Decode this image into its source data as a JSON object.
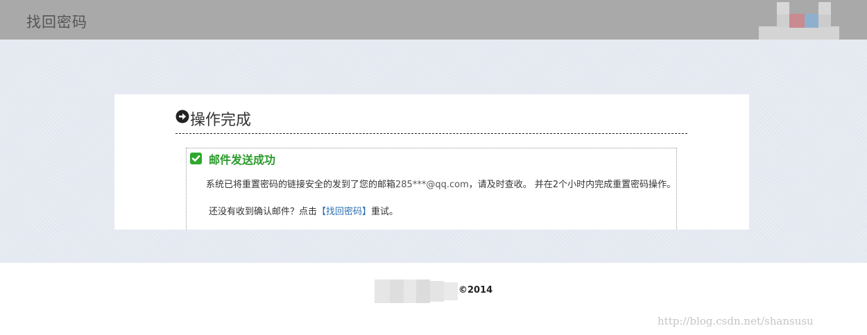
{
  "header": {
    "title": "找回密码"
  },
  "panel": {
    "heading": "操作完成",
    "heading_icon": "arrow-circle-right-icon"
  },
  "message": {
    "icon": "check-square-icon",
    "title": "邮件发送成功",
    "line1_before": "系统已将重置密码的链接安全的发到了您的邮箱",
    "email": "285***@qq.com",
    "line1_after": "，请及时查收。 并在2个小时内完成重置密码操作。",
    "line2_before": "还没有收到确认邮件？点击",
    "retry_link": "【找回密码】",
    "line2_after": "重试。"
  },
  "footer": {
    "copyright": "©2014"
  },
  "watermark": "http://blog.csdn.net/shansusu",
  "colors": {
    "header_bg": "#a9a9a9",
    "main_bg": "#e3e8f0",
    "success_green": "#2a9a2a",
    "link_blue": "#2a6fb5"
  }
}
